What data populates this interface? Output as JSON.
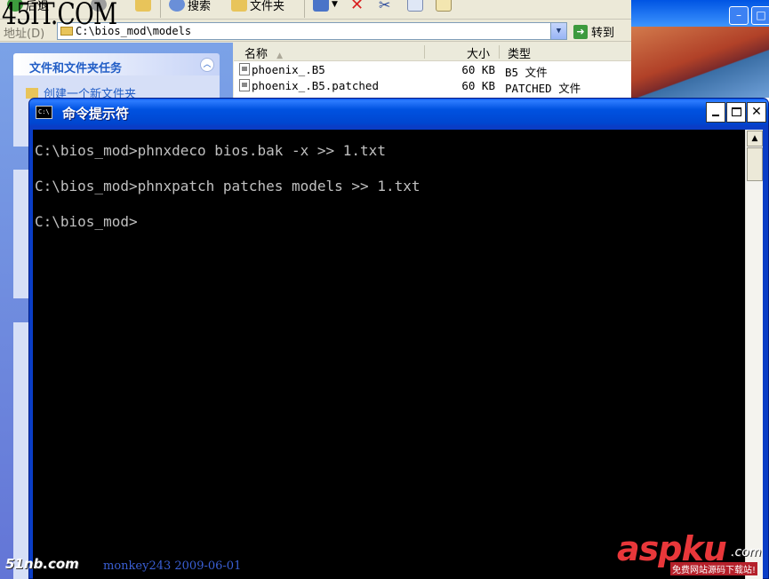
{
  "explorer": {
    "toolbar": {
      "back_label": "后退",
      "search_label": "搜索",
      "folders_label": "文件夹"
    },
    "address": {
      "label": "地址(D)",
      "value": "C:\\bios_mod\\models",
      "go_label": "转到"
    },
    "taskpane": {
      "group_title": "文件和文件夹任务",
      "first_item": "创建一个新文件夹"
    },
    "filelist": {
      "columns": {
        "name": "名称",
        "size": "大小",
        "type": "类型"
      },
      "rows": [
        {
          "name": "phoenix_.B5",
          "size": "60 KB",
          "type": "B5 文件"
        },
        {
          "name": "phoenix_.B5.patched",
          "size": "60 KB",
          "type": "PATCHED 文件"
        }
      ]
    }
  },
  "cmd": {
    "title": "命令提示符",
    "icon_text": "C:\\",
    "lines": [
      "C:\\bios_mod>phnxdeco bios.bak -x >> 1.txt",
      "C:\\bios_mod>phnxpatch patches models >> 1.txt",
      "C:\\bios_mod>"
    ]
  },
  "watermarks": {
    "top_left": "45IT.COM",
    "bottom_left": "51nb.com",
    "author_date": "monkey243   2009-06-01",
    "bottom_right": "aspku",
    "bottom_right_suffix": ".com",
    "bottom_right_sub": "免费网站源码下载站!"
  },
  "colors": {
    "console_bg": "#000000",
    "console_fg": "#c0c0c0",
    "titlebar_blue": "#0052e0",
    "watermark_red": "#e8373a"
  }
}
